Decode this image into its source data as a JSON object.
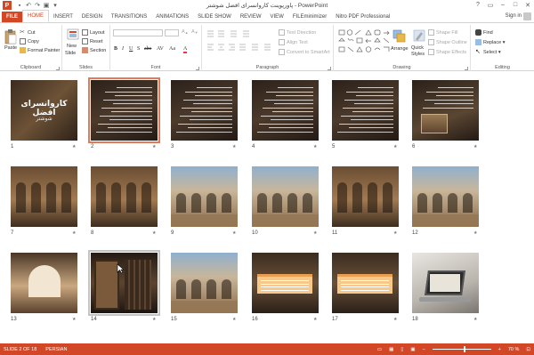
{
  "window": {
    "title": "پاورپوینت کاروانسرای افضل شوشتر - PowerPoint",
    "app_icon": "P",
    "controls": [
      "?",
      "▭",
      "–",
      "□",
      "✕"
    ]
  },
  "tabs": {
    "items": [
      "FILE",
      "HOME",
      "INSERT",
      "DESIGN",
      "TRANSITIONS",
      "ANIMATIONS",
      "SLIDE SHOW",
      "REVIEW",
      "VIEW",
      "FILEminimizer",
      "Nitro PDF Professional"
    ],
    "active": "HOME",
    "signin": "Sign in"
  },
  "ribbon": {
    "clipboard": {
      "label": "Clipboard",
      "paste": "Paste",
      "cut": "Cut",
      "copy": "Copy",
      "format_painter": "Format Painter"
    },
    "slides": {
      "label": "Slides",
      "new_slide": "New",
      "new_slide2": "Slide",
      "layout": "Layout",
      "reset": "Reset",
      "section": "Section"
    },
    "font": {
      "label": "Font",
      "bold": "B",
      "italic": "I",
      "underline": "U",
      "strike": "S",
      "abc": "abc",
      "av": "AV",
      "aa": "Aa",
      "font_color": "A"
    },
    "paragraph": {
      "label": "Paragraph",
      "text_direction": "Text Direction",
      "align_text": "Align Text",
      "convert_smartart": "Convert to SmartArt"
    },
    "drawing": {
      "label": "Drawing",
      "arrange": "Arrange",
      "quick_styles": "Quick Styles",
      "shape_fill": "Shape Fill",
      "shape_outline": "Shape Outline",
      "shape_effects": "Shape Effects"
    },
    "editing": {
      "label": "Editing",
      "find": "Find",
      "replace": "Replace",
      "select": "Select"
    }
  },
  "slides": [
    {
      "num": "1",
      "title": "کاروانسرای افضل",
      "subtitle": "شوشتر"
    },
    {
      "num": "2"
    },
    {
      "num": "3"
    },
    {
      "num": "4"
    },
    {
      "num": "5"
    },
    {
      "num": "6"
    },
    {
      "num": "7"
    },
    {
      "num": "8"
    },
    {
      "num": "9"
    },
    {
      "num": "10"
    },
    {
      "num": "11"
    },
    {
      "num": "12"
    },
    {
      "num": "13"
    },
    {
      "num": "14"
    },
    {
      "num": "15"
    },
    {
      "num": "16"
    },
    {
      "num": "17"
    },
    {
      "num": "18"
    }
  ],
  "star": "★",
  "status": {
    "slide_of": "SLIDE 2 OF 18",
    "language": "PERSIAN",
    "zoom": "70 %",
    "zoom_fraction": 0.55
  },
  "colors": {
    "accent": "#d24726",
    "selection": "#e07a5a",
    "thumb_dark": "#3a2a1e",
    "thumb_brown": "#6b4a30"
  }
}
